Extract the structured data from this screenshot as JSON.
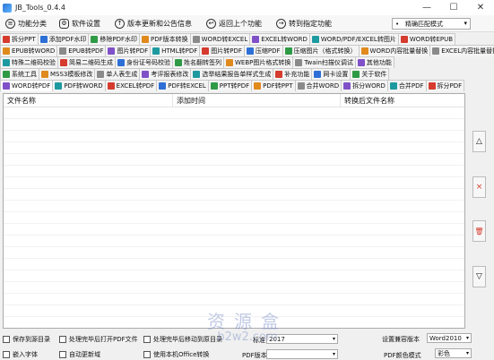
{
  "window": {
    "title": "JB_Tools_0.4.4",
    "minimize": "—",
    "maximize": "☐",
    "close": "✕"
  },
  "toolbar": {
    "items": [
      {
        "icon": "hamburger-icon",
        "label": "功能分类"
      },
      {
        "icon": "gear-icon",
        "label": "软件设置"
      },
      {
        "icon": "arrow-up-icon",
        "label": "版本更新和公告信息"
      },
      {
        "icon": "back-icon",
        "label": "返回上个功能"
      },
      {
        "icon": "forward-icon",
        "label": "转到指定功能"
      }
    ],
    "mode_select": {
      "value": "精确匹配模式"
    }
  },
  "tab_rows": [
    [
      "拆分PPT",
      "添加PDF水印",
      "移除PDF水印",
      "PDF版本转换",
      "WORD转EXCEL",
      "EXCEL转WORD",
      "WORD/PDF/EXCEL转图片",
      "WORD转EPUB"
    ],
    [
      "EPUB转WORD",
      "EPUB转PDF",
      "图片转PDF",
      "HTML转PDF",
      "图片转PDF",
      "压缩PDF",
      "压缩图片（格式转换）",
      "WORD内容批量替换",
      "EXCEL内容批量替换"
    ],
    [
      "特殊二维码校验",
      "简易二维码生成",
      "身份证号码校验",
      "姓名翻转签列",
      "WEBP图片格式转换",
      "Twain扫描仪调试",
      "其他功能"
    ],
    [
      "系统工具",
      "MSS3模板修改",
      "单人表生成",
      "考评报表修改",
      "选举结果报告单样式生成",
      "补充功能",
      "网卡设置",
      "关于软件"
    ],
    [
      "WORD转PDF",
      "PDF转WORD",
      "EXCEL转PDF",
      "PDF转EXCEL",
      "PPT转PDF",
      "PDF转PPT",
      "合并WORD",
      "拆分WORD",
      "合并PDF",
      "拆分PDF"
    ]
  ],
  "table": {
    "columns": [
      "文件名称",
      "添加时间",
      "转换后文件名称"
    ],
    "rows": []
  },
  "side_buttons": {
    "up": "△",
    "remove": "×",
    "clear": "🗑",
    "down": "▽"
  },
  "options": {
    "save_to_source": "保存到源目录",
    "open_pdf_after": "处理完毕后打开PDF文件",
    "shutdown_after": "处理完毕后移动到原目录",
    "standard_label": "标准",
    "standard_value": "2017",
    "compat_label": "设置兼容版本",
    "compat_value": "Word2010",
    "embed_font": "嵌入字体",
    "auto_update": "自动更新域",
    "use_office": "使用本机Office转换",
    "pdf_label": "PDF版本",
    "pdf_color_label": "PDF颜色模式",
    "pdf_color_value": "彩色"
  },
  "watermark": {
    "line1": "资源盒",
    "line2": "b2w2.com"
  },
  "colors": {
    "accent_red": "#d53b2e",
    "accent_blue": "#2d6fd6"
  }
}
